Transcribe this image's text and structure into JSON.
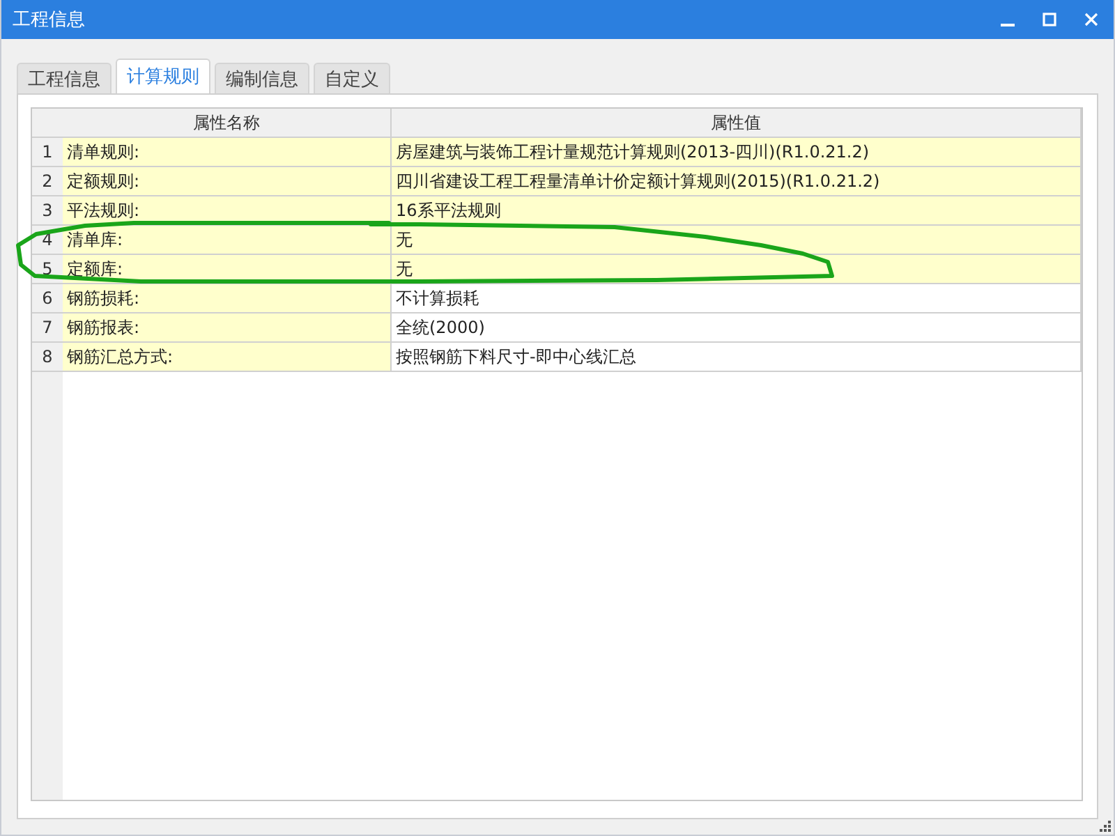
{
  "window": {
    "title": "工程信息"
  },
  "tabs": [
    {
      "label": "工程信息",
      "selected": false
    },
    {
      "label": "计算规则",
      "selected": true
    },
    {
      "label": "编制信息",
      "selected": false
    },
    {
      "label": "自定义",
      "selected": false
    }
  ],
  "table": {
    "columns": [
      "属性名称",
      "属性值"
    ],
    "rows": [
      {
        "index": "1",
        "name": "清单规则:",
        "value": "房屋建筑与装饰工程计量规范计算规则(2013-四川)(R1.0.21.2)",
        "highlighted": true
      },
      {
        "index": "2",
        "name": "定额规则:",
        "value": "四川省建设工程工程量清单计价定额计算规则(2015)(R1.0.21.2)",
        "highlighted": true
      },
      {
        "index": "3",
        "name": "平法规则:",
        "value": "16系平法规则",
        "highlighted": true
      },
      {
        "index": "4",
        "name": "清单库:",
        "value": "无",
        "highlighted": true
      },
      {
        "index": "5",
        "name": "定额库:",
        "value": "无",
        "highlighted": true
      },
      {
        "index": "6",
        "name": "钢筋损耗:",
        "value": "不计算损耗",
        "highlighted": false
      },
      {
        "index": "7",
        "name": "钢筋报表:",
        "value": "全统(2000)",
        "highlighted": false
      },
      {
        "index": "8",
        "name": "钢筋汇总方式:",
        "value": "按照钢筋下料尺寸-即中心线汇总",
        "highlighted": false
      }
    ]
  }
}
